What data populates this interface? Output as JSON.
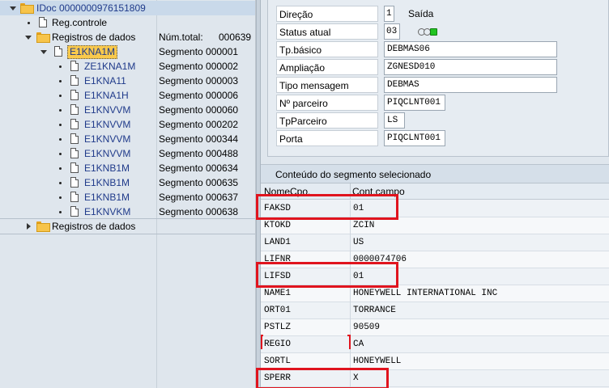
{
  "tree": {
    "root": "IDoc 0000000976151809",
    "reg_controle": "Reg.controle",
    "registros1": {
      "label": "Registros de dados",
      "col2": "Núm.total:",
      "col3": "000639"
    },
    "selected_segment": {
      "label": "E1KNA1M",
      "col2": "Segmento 000001"
    },
    "children": [
      {
        "label": "ZE1KNA1M",
        "seg": "Segmento 000002"
      },
      {
        "label": "E1KNA11",
        "seg": "Segmento 000003"
      },
      {
        "label": "E1KNA1H",
        "seg": "Segmento 000006"
      },
      {
        "label": "E1KNVVM",
        "seg": "Segmento 000060"
      },
      {
        "label": "E1KNVVM",
        "seg": "Segmento 000202"
      },
      {
        "label": "E1KNVVM",
        "seg": "Segmento 000344"
      },
      {
        "label": "E1KNVVM",
        "seg": "Segmento 000488"
      },
      {
        "label": "E1KNB1M",
        "seg": "Segmento 000634"
      },
      {
        "label": "E1KNB1M",
        "seg": "Segmento 000635"
      },
      {
        "label": "E1KNB1M",
        "seg": "Segmento 000637"
      },
      {
        "label": "E1KNVKM",
        "seg": "Segmento 000638"
      }
    ],
    "registros2": "Registros de dados"
  },
  "header": {
    "direcao_label": "Direção",
    "direcao_value": "1",
    "direcao_text": "Saída",
    "status_label": "Status atual",
    "status_value": "03",
    "tp_basico_label": "Tp.básico",
    "tp_basico_value": "DEBMAS06",
    "ampliacao_label": "Ampliação",
    "ampliacao_value": "ZGNESD010",
    "tipo_mensagem_label": "Tipo mensagem",
    "tipo_mensagem_value": "DEBMAS",
    "parceiro_label": "Nº parceiro",
    "parceiro_value": "PIQCLNT001",
    "tp_parceiro_label": "TpParceiro",
    "tp_parceiro_value": "LS",
    "porta_label": "Porta",
    "porta_value": "PIQCLNT001"
  },
  "segment": {
    "title": "Conteúdo do segmento selecionado",
    "col_name": "NomeCpo.",
    "col_value": "Cont.campo",
    "rows": [
      {
        "k": "FAKSD",
        "v": "01"
      },
      {
        "k": "KTOKD",
        "v": "ZCIN"
      },
      {
        "k": "LAND1",
        "v": "US"
      },
      {
        "k": "LIFNR",
        "v": "0000074706"
      },
      {
        "k": "LIFSD",
        "v": "01"
      },
      {
        "k": "NAME1",
        "v": "HONEYWELL INTERNATIONAL INC"
      },
      {
        "k": "ORT01",
        "v": "TORRANCE"
      },
      {
        "k": "PSTLZ",
        "v": "90509"
      },
      {
        "k": "REGIO",
        "v": "CA"
      },
      {
        "k": "SORTL",
        "v": "HONEYWELL"
      },
      {
        "k": "SPERR",
        "v": "X"
      }
    ]
  },
  "colors": {
    "highlight": "#e0141e",
    "selected_node": "#f9c94c",
    "tree_link": "#1f3a8a"
  }
}
